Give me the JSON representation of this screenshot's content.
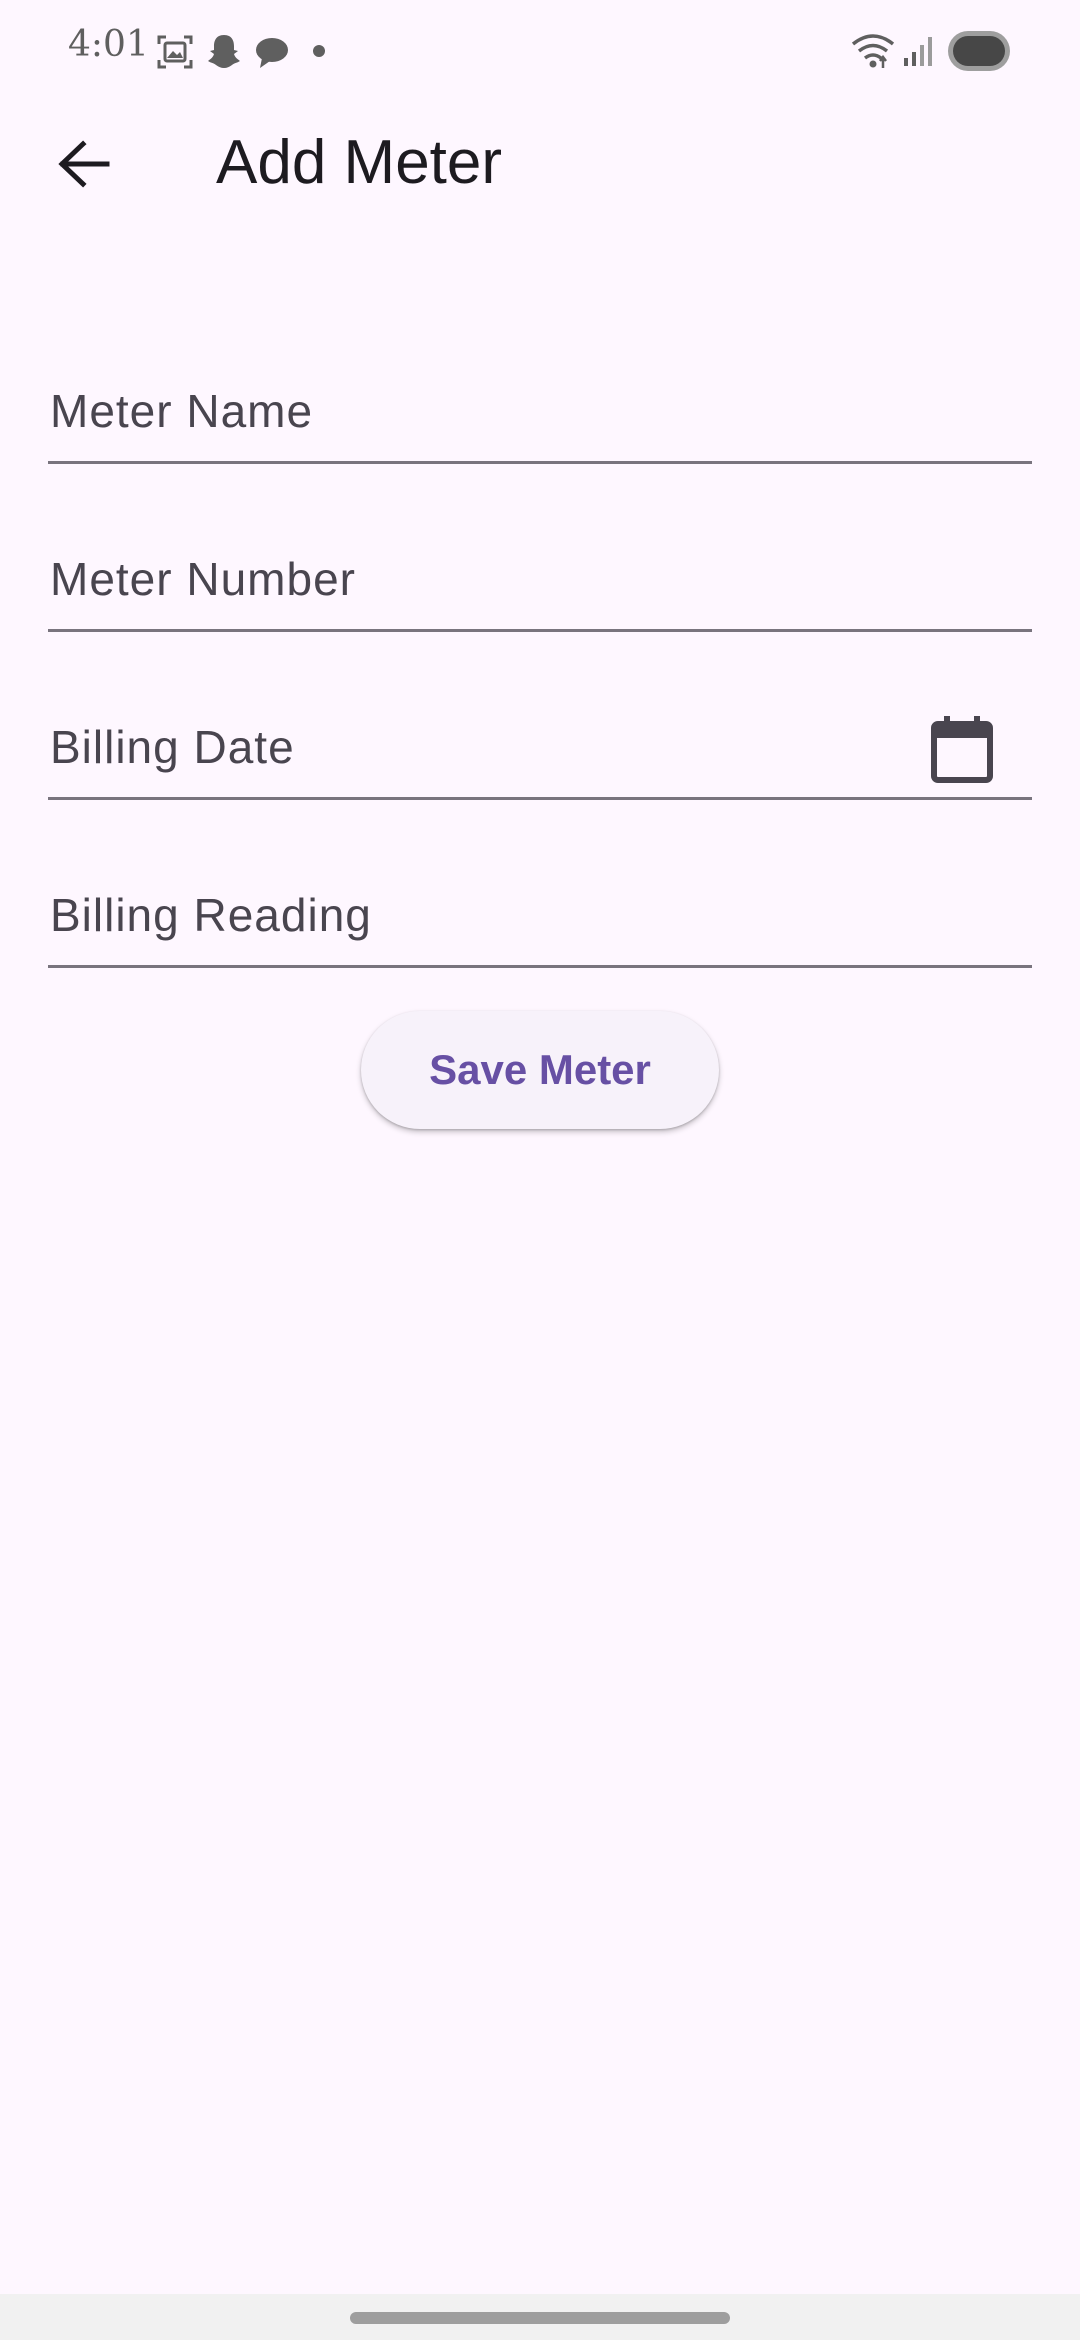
{
  "status_bar": {
    "time": "4:01",
    "icons": [
      "screenshot-icon",
      "snapchat-icon",
      "chat-icon",
      "dot-icon",
      "wifi-icon",
      "signal-icon",
      "battery-icon"
    ]
  },
  "app_bar": {
    "title": "Add Meter",
    "back_icon": "arrow-back-icon"
  },
  "form": {
    "fields": [
      {
        "label": "Meter Name",
        "value": ""
      },
      {
        "label": "Meter Number",
        "value": ""
      },
      {
        "label": "Billing Date",
        "value": "",
        "trailing_icon": "calendar-icon"
      },
      {
        "label": "Billing Reading",
        "value": ""
      }
    ],
    "save_label": "Save Meter"
  },
  "colors": {
    "background": "#fef7ff",
    "accent": "#6750a4",
    "underline": "#79747e",
    "label": "#49454f"
  }
}
